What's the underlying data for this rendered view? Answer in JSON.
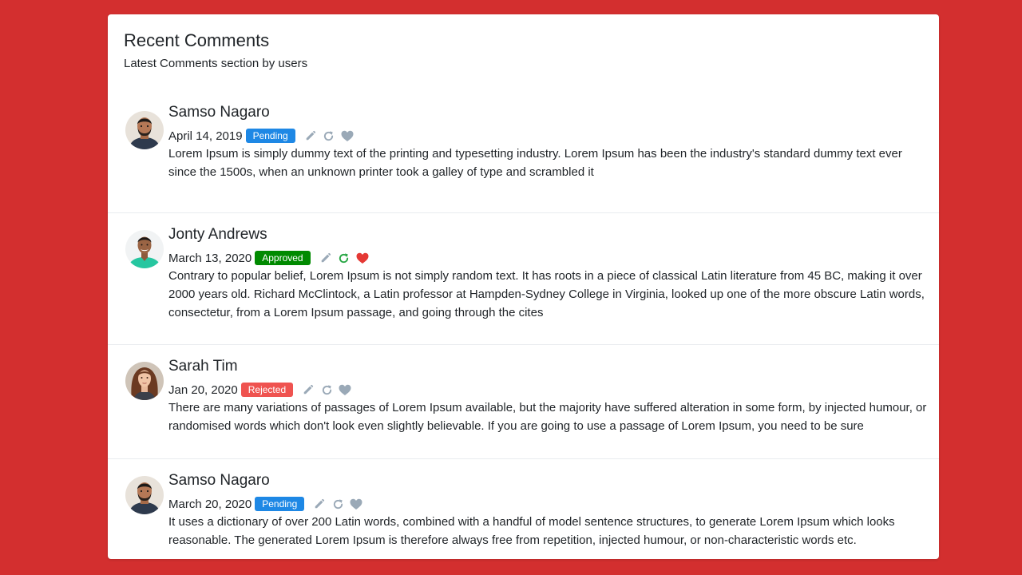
{
  "header": {
    "title": "Recent Comments",
    "subtitle": "Latest Comments section by users"
  },
  "comments": [
    {
      "name": "Samso Nagaro",
      "date": "April 14, 2019",
      "status": "Pending",
      "status_color": "#1e88e5",
      "refresh_color": "#9aa9b7",
      "heart_color": "#9aa9b7",
      "text": "Lorem Ipsum is simply dummy text of the printing and typesetting industry. Lorem Ipsum has been the industry's standard dummy text ever since the 1500s, when an unknown printer took a galley of type and scrambled it"
    },
    {
      "name": "Jonty Andrews",
      "date": "March 13, 2020",
      "status": "Approved",
      "status_color": "#008a00",
      "refresh_color": "#28a745",
      "heart_color": "#e53935",
      "text": "Contrary to popular belief, Lorem Ipsum is not simply random text. It has roots in a piece of classical Latin literature from 45 BC, making it over 2000 years old. Richard McClintock, a Latin professor at Hampden-Sydney College in Virginia, looked up one of the more obscure Latin words, consectetur, from a Lorem Ipsum passage, and going through the cites"
    },
    {
      "name": "Sarah Tim",
      "date": "Jan 20, 2020",
      "status": "Rejected",
      "status_color": "#ef5350",
      "refresh_color": "#9aa9b7",
      "heart_color": "#9aa9b7",
      "text": "There are many variations of passages of Lorem Ipsum available, but the majority have suffered alteration in some form, by injected humour, or randomised words which don't look even slightly believable. If you are going to use a passage of Lorem Ipsum, you need to be sure"
    },
    {
      "name": "Samso Nagaro",
      "date": "March 20, 2020",
      "status": "Pending",
      "status_color": "#1e88e5",
      "refresh_color": "#9aa9b7",
      "heart_color": "#9aa9b7",
      "text": "It uses a dictionary of over 200 Latin words, combined with a handful of model sentence structures, to generate Lorem Ipsum which looks reasonable. The generated Lorem Ipsum is therefore always free from repetition, injected humour, or non-characteristic words etc."
    }
  ],
  "icons": {
    "edit": "pencil-icon",
    "refresh": "refresh-icon",
    "like": "heart-icon"
  },
  "colors": {
    "background": "#d32f2f",
    "card": "#ffffff",
    "icon_muted": "#9aa9b7"
  }
}
